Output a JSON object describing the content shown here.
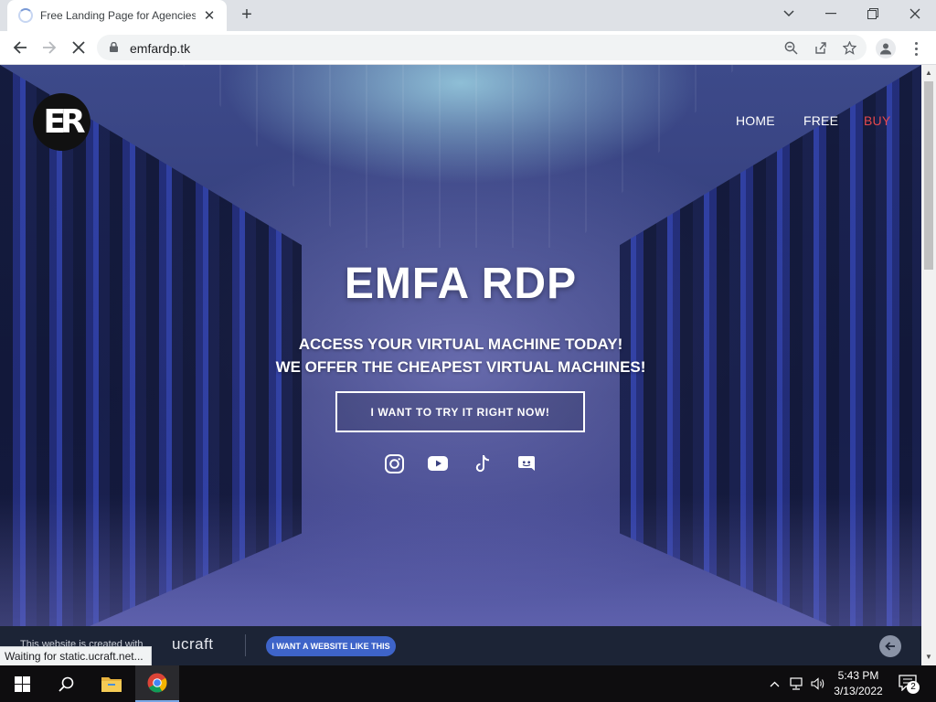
{
  "browser": {
    "tab_title": "Free Landing Page for Agencies - ",
    "tab_close": "✕",
    "new_tab": "+",
    "url": "emfardp.tk",
    "window_controls": [
      "chevron-down-icon",
      "minimize-icon",
      "restore-icon",
      "close-icon"
    ],
    "nav_icons": [
      "back-arrow-icon",
      "forward-arrow-icon",
      "stop-loading-icon"
    ],
    "omnibox_icons": [
      "zoom-out-icon",
      "share-icon",
      "bookmark-star-icon"
    ],
    "status_text": "Waiting for static.ucraft.net..."
  },
  "page": {
    "logo_text": "ER",
    "nav": [
      {
        "label": "HOME",
        "color": "#ffffff"
      },
      {
        "label": "FREE",
        "color": "#ffffff"
      },
      {
        "label": "BUY",
        "color": "#e5484d"
      }
    ],
    "hero_title": "EMFA RDP",
    "subtitle_1": "ACCESS YOUR VIRTUAL MACHINE TODAY!",
    "subtitle_2": "WE OFFER THE CHEAPEST VIRTUAL MACHINES!",
    "cta_label": "I WANT TO TRY IT RIGHT NOW!",
    "social": [
      "instagram-icon",
      "youtube-icon",
      "tiktok-icon",
      "discord-icon"
    ]
  },
  "promo_bar": {
    "made_with": "This website is created with",
    "brand": "ucraft",
    "button": "I WANT A WEBSITE LIKE THIS",
    "accent": "#3e64c9"
  },
  "taskbar": {
    "apps": [
      "windows-start-icon",
      "search-icon",
      "file-explorer-icon",
      "chrome-icon"
    ],
    "tray": [
      "chevron-up-icon",
      "network-icon",
      "volume-icon"
    ],
    "time": "5:43 PM",
    "date": "3/13/2022",
    "notifications": "2"
  }
}
